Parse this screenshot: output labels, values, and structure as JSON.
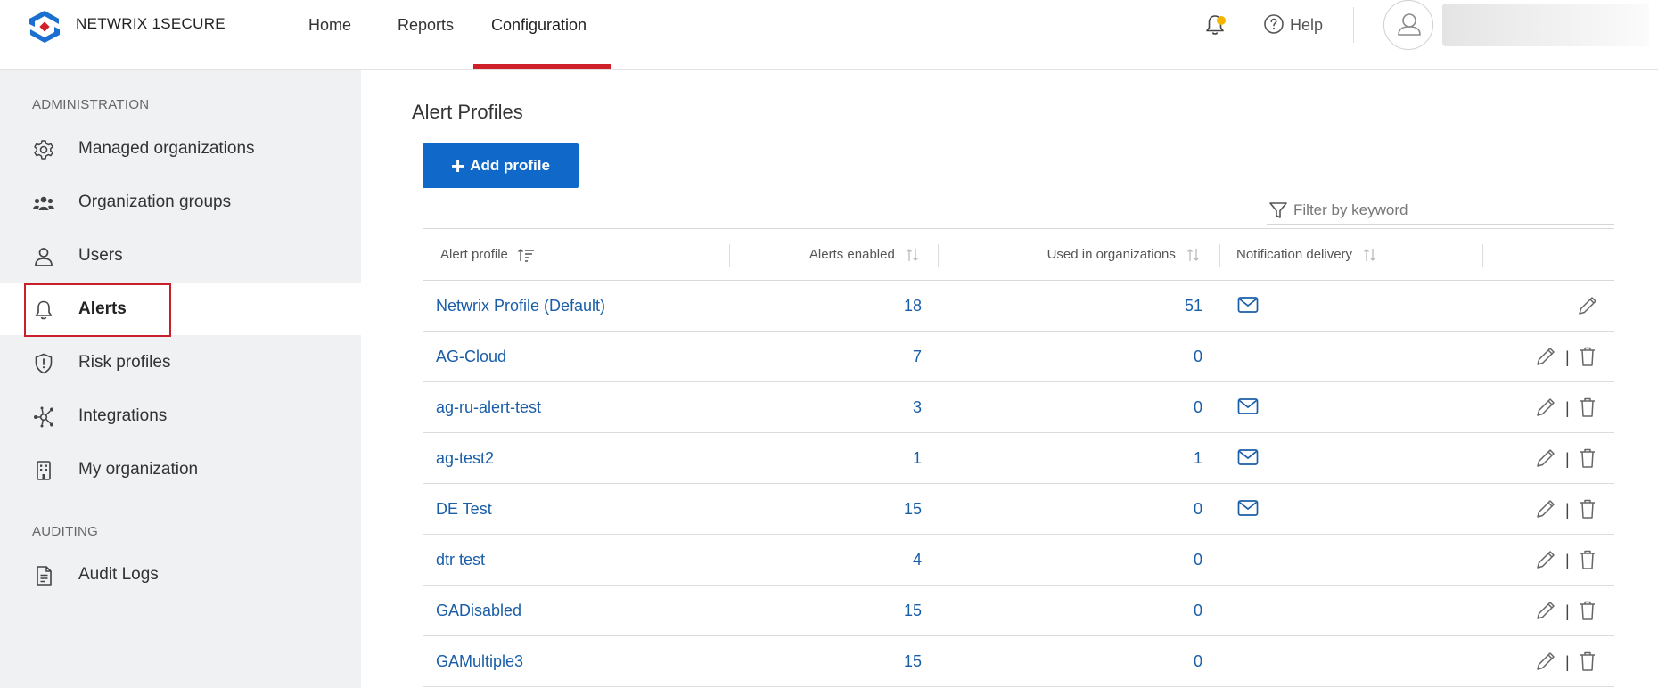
{
  "header": {
    "brand": "NETWRIX 1SECURE",
    "nav": [
      "Home",
      "Reports",
      "Configuration"
    ],
    "active_nav": "Configuration",
    "help_label": "Help",
    "accent_color": "#d0212b",
    "notification_dot_color": "#f2b600"
  },
  "sidebar": {
    "sections": [
      {
        "label": "ADMINISTRATION",
        "items": [
          {
            "label": "Managed organizations",
            "icon": "gear-icon"
          },
          {
            "label": "Organization groups",
            "icon": "group-icon"
          },
          {
            "label": "Users",
            "icon": "user-icon"
          },
          {
            "label": "Alerts",
            "icon": "bell-icon",
            "selected": true
          },
          {
            "label": "Risk profiles",
            "icon": "shield-icon"
          },
          {
            "label": "Integrations",
            "icon": "network-icon"
          },
          {
            "label": "My organization",
            "icon": "building-icon"
          }
        ]
      },
      {
        "label": "AUDITING",
        "items": [
          {
            "label": "Audit Logs",
            "icon": "document-icon"
          }
        ]
      }
    ]
  },
  "main": {
    "title": "Alert Profiles",
    "add_button": "Add profile",
    "filter_placeholder": "Filter by keyword",
    "columns": [
      "Alert profile",
      "Alerts enabled",
      "Used in organizations",
      "Notification delivery"
    ],
    "rows": [
      {
        "name": "Netwrix Profile (Default)",
        "alerts_enabled": "18",
        "used_in_orgs": "51",
        "email": true,
        "deletable": false
      },
      {
        "name": "AG-Cloud",
        "alerts_enabled": "7",
        "used_in_orgs": "0",
        "email": false,
        "deletable": true
      },
      {
        "name": "ag-ru-alert-test",
        "alerts_enabled": "3",
        "used_in_orgs": "0",
        "email": true,
        "deletable": true
      },
      {
        "name": "ag-test2",
        "alerts_enabled": "1",
        "used_in_orgs": "1",
        "email": true,
        "deletable": true
      },
      {
        "name": "DE Test",
        "alerts_enabled": "15",
        "used_in_orgs": "0",
        "email": true,
        "deletable": true
      },
      {
        "name": "dtr test",
        "alerts_enabled": "4",
        "used_in_orgs": "0",
        "email": false,
        "deletable": true
      },
      {
        "name": "GADisabled",
        "alerts_enabled": "15",
        "used_in_orgs": "0",
        "email": false,
        "deletable": true
      },
      {
        "name": "GAMultiple3",
        "alerts_enabled": "15",
        "used_in_orgs": "0",
        "email": false,
        "deletable": true
      }
    ],
    "link_color": "#1a5ea8",
    "button_color": "#1068c9"
  }
}
